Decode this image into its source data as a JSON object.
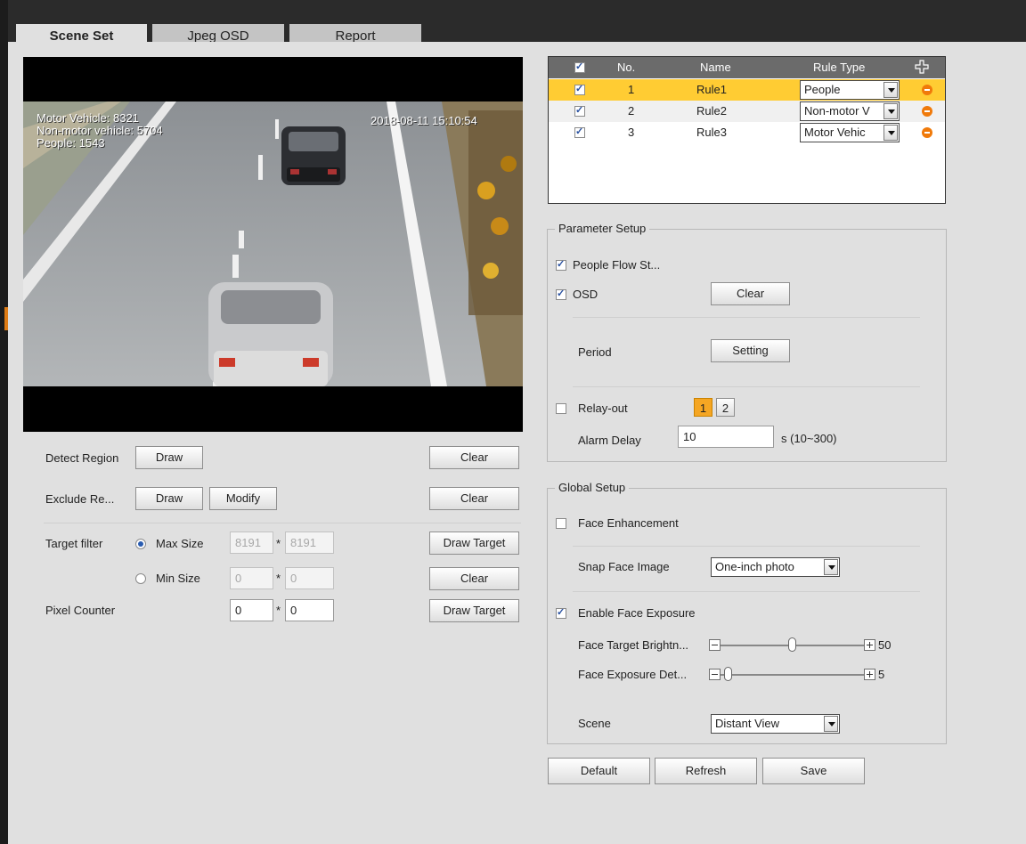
{
  "tabs": [
    {
      "label": "Scene Set",
      "active": true
    },
    {
      "label": "Jpeg OSD",
      "active": false
    },
    {
      "label": "Report",
      "active": false
    }
  ],
  "video": {
    "osd_lines": [
      "Motor Vehicle: 8321",
      "Non-motor vehicle: 5704",
      "People: 1543"
    ],
    "timestamp": "2018-08-11 15:10:54"
  },
  "left": {
    "detect_region": {
      "label": "Detect Region",
      "draw": "Draw",
      "clear": "Clear"
    },
    "exclude_region": {
      "label": "Exclude Re...",
      "draw": "Draw",
      "modify": "Modify",
      "clear": "Clear"
    },
    "target_filter": {
      "label": "Target filter",
      "max_size_label": "Max Size",
      "max_w": "8191",
      "max_h": "8191",
      "min_size_label": "Min Size",
      "min_w": "0",
      "min_h": "0",
      "times": "*",
      "draw_target": "Draw Target",
      "clear": "Clear"
    },
    "pixel_counter": {
      "label": "Pixel Counter",
      "w": "0",
      "h": "0",
      "times": "*",
      "draw_target": "Draw Target"
    }
  },
  "rules": {
    "headers": {
      "no": "No.",
      "name": "Name",
      "rule_type": "Rule Type"
    },
    "rows": [
      {
        "no": "1",
        "name": "Rule1",
        "type": "People",
        "checked": true,
        "selected": true
      },
      {
        "no": "2",
        "name": "Rule2",
        "type": "Non-motor V",
        "checked": true,
        "selected": false
      },
      {
        "no": "3",
        "name": "Rule3",
        "type": "Motor Vehic",
        "checked": true,
        "selected": false
      }
    ]
  },
  "parameter_setup": {
    "title": "Parameter Setup",
    "people_flow": "People Flow St...",
    "osd": "OSD",
    "osd_clear": "Clear",
    "period": "Period",
    "period_setting": "Setting",
    "relay_out": "Relay-out",
    "relay_1": "1",
    "relay_2": "2",
    "alarm_delay": "Alarm Delay",
    "alarm_delay_value": "10",
    "alarm_delay_range": "s (10~300)"
  },
  "global_setup": {
    "title": "Global Setup",
    "face_enhancement": "Face Enhancement",
    "snap_face_image": "Snap Face Image",
    "snap_face_value": "One-inch photo",
    "enable_face_exposure": "Enable Face Exposure",
    "face_target_brightness": "Face Target Brightn...",
    "face_target_brightness_value": "50",
    "face_exposure_det": "Face Exposure Det...",
    "face_exposure_det_value": "5",
    "scene": "Scene",
    "scene_value": "Distant View"
  },
  "footer": {
    "default": "Default",
    "refresh": "Refresh",
    "save": "Save"
  },
  "colors": {
    "selected_row": "#ffcc33",
    "accent_orange": "#f07a0a",
    "relay_active": "#f5a623"
  },
  "slider_levels": {
    "face_target_brightness_fraction": 0.5,
    "face_exposure_det_fraction": 0.05
  }
}
